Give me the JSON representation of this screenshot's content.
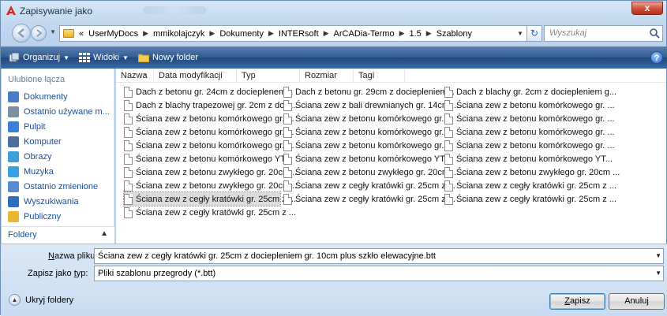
{
  "window": {
    "title": "Zapisywanie jako",
    "close_label": "x"
  },
  "address": {
    "prefix": "«",
    "crumbs": [
      "UserMyDocs",
      "mmikolajczyk",
      "Dokumenty",
      "INTERsoft",
      "ArCADia-Termo",
      "1.5",
      "Szablony"
    ],
    "search_placeholder": "Wyszukaj"
  },
  "toolbar": {
    "organize": "Organizuj",
    "views": "Widoki",
    "new_folder": "Nowy folder",
    "help": "?"
  },
  "navpane": {
    "favorites_header": "Ulubione łącza",
    "items": [
      {
        "label": "Dokumenty",
        "icon": "documents-icon",
        "color": "#4a7bc4"
      },
      {
        "label": "Ostatnio używane m...",
        "icon": "recent-places-icon",
        "color": "#7f8fa6"
      },
      {
        "label": "Pulpit",
        "icon": "desktop-icon",
        "color": "#3d7fd6"
      },
      {
        "label": "Komputer",
        "icon": "computer-icon",
        "color": "#4d6f9a"
      },
      {
        "label": "Obrazy",
        "icon": "pictures-icon",
        "color": "#3f9fd8"
      },
      {
        "label": "Muzyka",
        "icon": "music-icon",
        "color": "#3aa0e0"
      },
      {
        "label": "Ostatnio zmienione",
        "icon": "recently-changed-icon",
        "color": "#5a8ad0"
      },
      {
        "label": "Wyszukiwania",
        "icon": "searches-icon",
        "color": "#2f6cc0"
      },
      {
        "label": "Publiczny",
        "icon": "public-folder-icon",
        "color": "#e8b730"
      }
    ],
    "folders_label": "Foldery"
  },
  "columns": [
    "Nazwa",
    "Data modyfikacji",
    "Typ",
    "Rozmiar",
    "Tagi"
  ],
  "files": [
    {
      "name": "Dach z betonu gr. 24cm z docieplenem..."
    },
    {
      "name": "Dach z blachy trapezowej gr. 2cm z doci..."
    },
    {
      "name": "Ściana zew z betonu komórkowego gr. ..."
    },
    {
      "name": "Ściana zew z betonu komórkowego gr. ..."
    },
    {
      "name": "Ściana zew z betonu komórkowego gr. ..."
    },
    {
      "name": "Ściana zew z betonu komórkowego YT..."
    },
    {
      "name": "Ściana zew z betonu zwykłego gr. 20cm ..."
    },
    {
      "name": "Ściana zew z betonu zwykłego gr. 20cm ..."
    },
    {
      "name": "Ściana zew z cegły kratówki gr. 25cm z ..."
    },
    {
      "name": "Ściana zew z cegły kratówki gr. 25cm z ..."
    },
    {
      "name": "Dach z betonu gr. 29cm z dociepleniem..."
    },
    {
      "name": "Ściana zew z bali drewnianych gr. 14cm ..."
    },
    {
      "name": "Ściana zew z betonu komórkowego gr. ..."
    },
    {
      "name": "Ściana zew z betonu komórkowego gr. ..."
    },
    {
      "name": "Ściana zew z betonu komórkowego gr. ..."
    },
    {
      "name": "Ściana zew z betonu komórkowego YT..."
    },
    {
      "name": "Ściana zew z betonu zwykłego gr. 20cm ..."
    },
    {
      "name": "Ściana zew z cegły kratówki gr. 25cm z ..."
    },
    {
      "name": "Ściana zew z cegły kratówki gr. 25cm z ..."
    },
    {
      "name": "Dach z blachy gr. 2cm z dociepleniem g..."
    },
    {
      "name": "Ściana zew z betonu komórkowego gr. ..."
    },
    {
      "name": "Ściana zew z betonu komórkowego gr. ..."
    },
    {
      "name": "Ściana zew z betonu komórkowego gr. ..."
    },
    {
      "name": "Ściana zew z betonu komórkowego gr. ..."
    },
    {
      "name": "Ściana zew z betonu komórkowego YT..."
    },
    {
      "name": "Ściana zew z betonu zwykłego gr. 20cm ..."
    },
    {
      "name": "Ściana zew z cegły kratówki gr. 25cm z ..."
    },
    {
      "name": "Ściana zew z cegły kratówki gr. 25cm z ..."
    }
  ],
  "form": {
    "filename_label": "Nazwa pliku:",
    "filename_value": "Ściana zew z cegły kratówki gr. 25cm z dociepleniem gr. 10cm plus szkło elewacyjne.btt",
    "type_label": "Zapisz jako typ:",
    "type_value": "Pliki szablonu przegrody (*.btt)",
    "hide_folders": "Ukryj foldery",
    "save": "Zapisz",
    "cancel": "Anuluj"
  },
  "colors": {
    "toolbar": "#2f5b92",
    "link": "#1a4fa0",
    "selection": "#dcdcdc"
  }
}
